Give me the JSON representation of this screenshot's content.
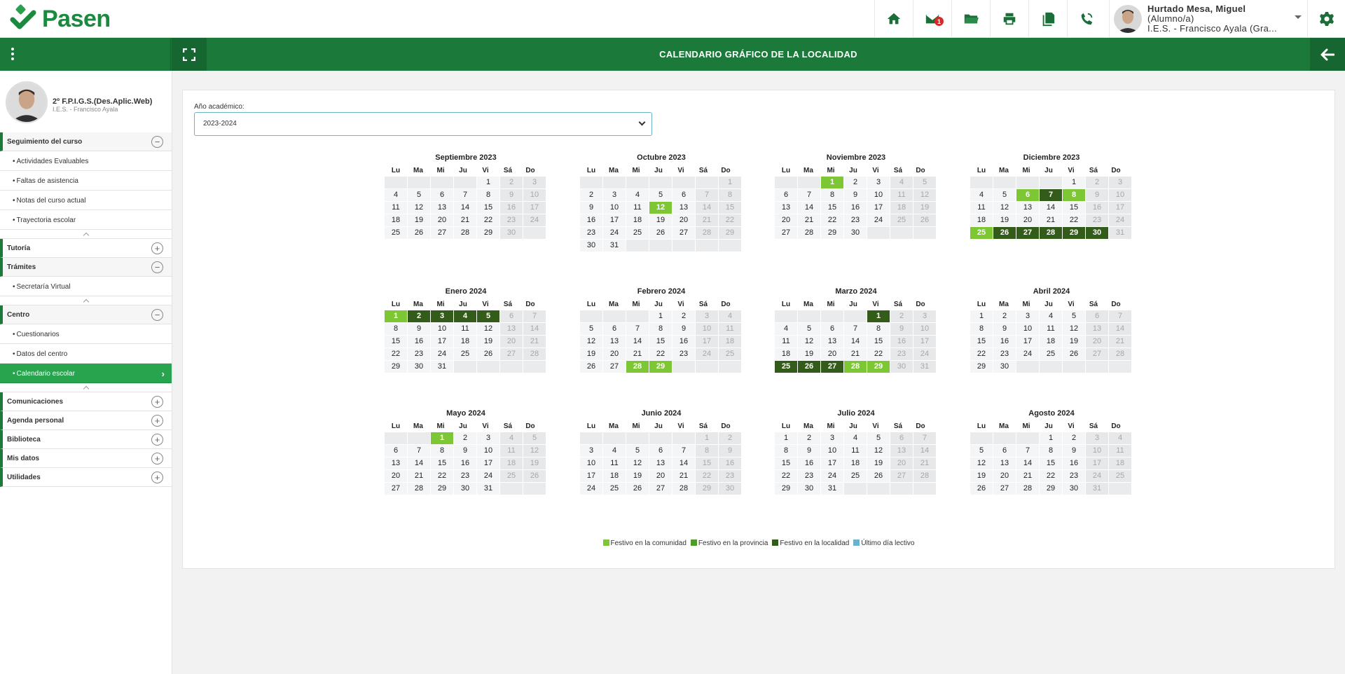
{
  "app": {
    "name": "Pasen"
  },
  "header": {
    "user_name": "Hurtado Mesa, Miguel",
    "user_role": "(Alumno/a)",
    "user_center": "I.E.S. - Francisco Ayala (Gra...",
    "mail_badge": "1",
    "icons": [
      "home-icon",
      "mail-icon",
      "folder-icon",
      "print-icon",
      "documents-icon",
      "phone-icon",
      "gear-icon"
    ]
  },
  "titlebar": {
    "title": "CALENDARIO GRÁFICO DE LA LOCALIDAD"
  },
  "sidebar": {
    "course": "2º F.P.I.G.S.(Des.Aplic.Web)",
    "center": "I.E.S. - Francisco Ayala",
    "sections": [
      {
        "label": "Seguimiento del curso",
        "open": true,
        "items": [
          "Actividades Evaluables",
          "Faltas de asistencia",
          "Notas del curso actual",
          "Trayectoria escolar"
        ]
      },
      {
        "label": "Tutoría",
        "open": false,
        "items": []
      },
      {
        "label": "Trámites",
        "open": true,
        "items": [
          "Secretaría Virtual"
        ]
      },
      {
        "label": "Centro",
        "open": true,
        "items": [
          "Cuestionarios",
          "Datos del centro",
          "Calendario escolar"
        ],
        "active": "Calendario escolar"
      },
      {
        "label": "Comunicaciones",
        "open": false,
        "items": []
      },
      {
        "label": "Agenda personal",
        "open": false,
        "items": []
      },
      {
        "label": "Biblioteca",
        "open": false,
        "items": []
      },
      {
        "label": "Mis datos",
        "open": false,
        "items": []
      },
      {
        "label": "Utilidades",
        "open": false,
        "items": []
      }
    ]
  },
  "main": {
    "year_label": "Año académico:",
    "year_value": "2023-2024",
    "dow": [
      "Lu",
      "Ma",
      "Mi",
      "Ju",
      "Vi",
      "Sá",
      "Do"
    ],
    "months": [
      {
        "title": "Septiembre  2023",
        "offset": 4,
        "days": 30,
        "com": [],
        "loc": []
      },
      {
        "title": "Octubre  2023",
        "offset": 6,
        "days": 31,
        "com": [
          12
        ],
        "loc": []
      },
      {
        "title": "Noviembre  2023",
        "offset": 2,
        "days": 30,
        "com": [
          1
        ],
        "loc": []
      },
      {
        "title": "Diciembre  2023",
        "offset": 4,
        "days": 31,
        "com": [
          6,
          8,
          25
        ],
        "loc": [
          7,
          26,
          27,
          28,
          29,
          30
        ]
      },
      {
        "title": "Enero  2024",
        "offset": 0,
        "days": 31,
        "com": [
          1
        ],
        "loc": [
          2,
          3,
          4,
          5
        ]
      },
      {
        "title": "Febrero  2024",
        "offset": 3,
        "days": 29,
        "com": [
          28,
          29
        ],
        "loc": []
      },
      {
        "title": "Marzo  2024",
        "offset": 4,
        "days": 31,
        "com": [
          28,
          29
        ],
        "loc": [
          1,
          25,
          26,
          27
        ]
      },
      {
        "title": "Abril  2024",
        "offset": 0,
        "days": 30,
        "com": [],
        "loc": []
      },
      {
        "title": "Mayo  2024",
        "offset": 2,
        "days": 31,
        "com": [
          1
        ],
        "loc": []
      },
      {
        "title": "Junio  2024",
        "offset": 5,
        "days": 30,
        "com": [],
        "loc": []
      },
      {
        "title": "Julio  2024",
        "offset": 0,
        "days": 31,
        "com": [],
        "loc": []
      },
      {
        "title": "Agosto  2024",
        "offset": 3,
        "days": 31,
        "com": [],
        "loc": []
      }
    ],
    "legend": [
      {
        "label": "Festivo en la comunidad",
        "color": "#7ec734"
      },
      {
        "label": "Festivo en la provincia",
        "color": "#4f9a2a"
      },
      {
        "label": "Festivo en la localidad",
        "color": "#335b1a"
      },
      {
        "label": "Último día lectivo",
        "color": "#6ab0cf"
      }
    ]
  }
}
